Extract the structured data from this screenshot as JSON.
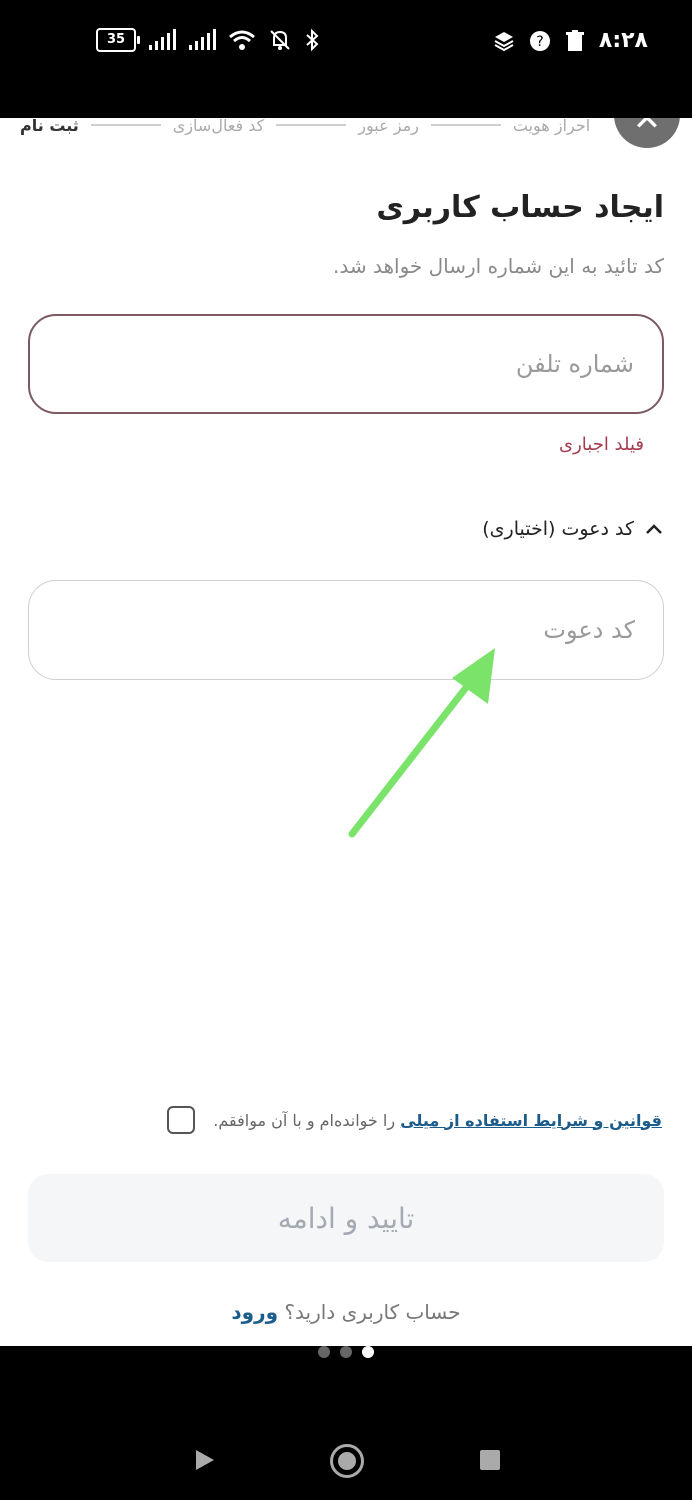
{
  "status_bar": {
    "battery_level": "35",
    "time": "۸:۲۸",
    "icons": [
      "signal-icon",
      "signal-icon",
      "wifi-icon",
      "bell-muted-icon",
      "bluetooth-icon",
      "layers-icon",
      "question-icon",
      "trash-icon"
    ]
  },
  "stepper": {
    "steps": [
      "ثبت نام",
      "کد فعال‌سازی",
      "رمز عبور",
      "احراز هویت"
    ],
    "active_index": 0
  },
  "form": {
    "title": "ایجاد حساب کاربری",
    "subtitle": "کد تائید به این شماره ارسال خواهد شد.",
    "phone_placeholder": "شماره تلفن",
    "required_label": "فیلد اجباری",
    "invite_toggle_label": "کد دعوت (اختیاری)",
    "invite_placeholder": "کد دعوت"
  },
  "terms": {
    "link_text": "قوانین و شرایط استفاده از میلی",
    "rest_text": " را خوانده‌ام و با آن موافقم."
  },
  "actions": {
    "confirm_label": "تایید و ادامه",
    "have_account_text": "حساب کاربری دارید؟ ",
    "login_label": "ورود"
  },
  "pager": {
    "count": 3,
    "active_index": 2
  },
  "colors": {
    "error": "#a63b4f",
    "link": "#1b5c8a",
    "annotation_arrow": "#7be36a"
  }
}
